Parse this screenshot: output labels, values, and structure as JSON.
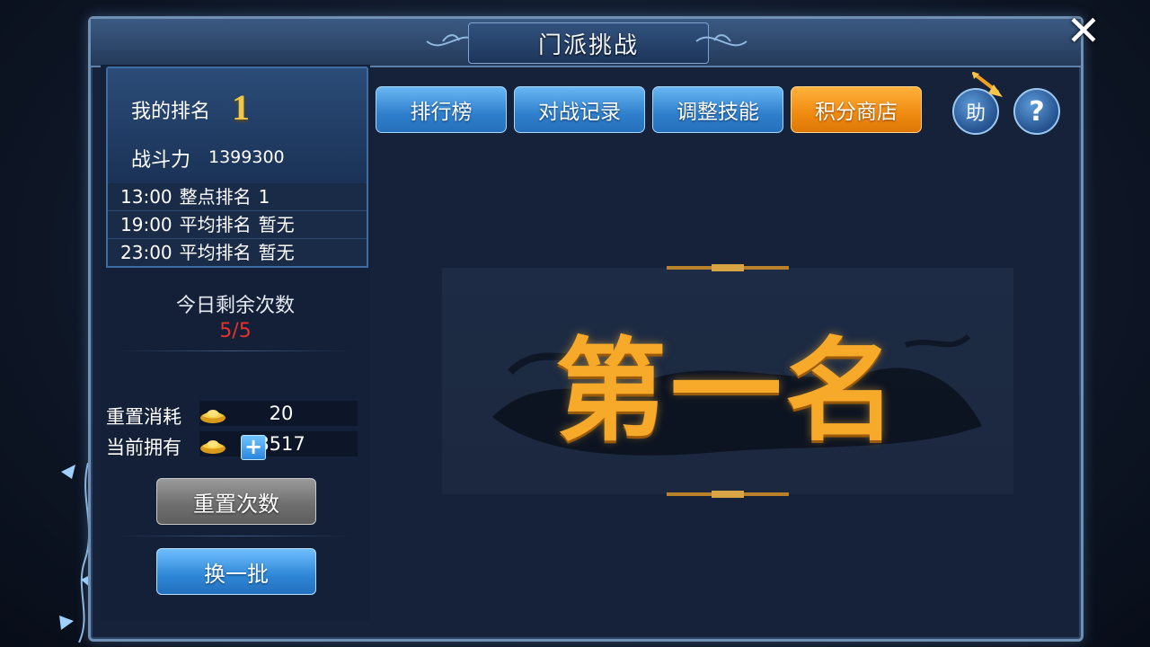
{
  "window": {
    "title": "门派挑战",
    "close_icon": "close-icon"
  },
  "rank_panel": {
    "rank_label": "我的排名",
    "rank_value": "1",
    "power_label": "战斗力",
    "power_value": "1399300"
  },
  "schedule": [
    {
      "time": "13:00",
      "label": "整点排名",
      "value": "1"
    },
    {
      "time": "19:00",
      "label": "平均排名",
      "value": "暂无"
    },
    {
      "time": "23:00",
      "label": "平均排名",
      "value": "暂无"
    }
  ],
  "remaining": {
    "label": "今日剩余次数",
    "value": "5/5"
  },
  "costs": {
    "reset_cost_label": "重置消耗",
    "reset_cost_value": "20",
    "owned_label": "当前拥有",
    "owned_value": "8517"
  },
  "buttons": {
    "reset": "重置次数",
    "refresh": "换一批",
    "help": "助",
    "question": "?"
  },
  "tabs": [
    "排行榜",
    "对战记录",
    "调整技能",
    "积分商店"
  ],
  "banner": {
    "text": "第一名"
  },
  "colors": {
    "accent_orange": "#ef8a10",
    "accent_blue": "#2f7fcc",
    "remaining_red": "#e4322c",
    "rank_gold": "#f0c648"
  }
}
